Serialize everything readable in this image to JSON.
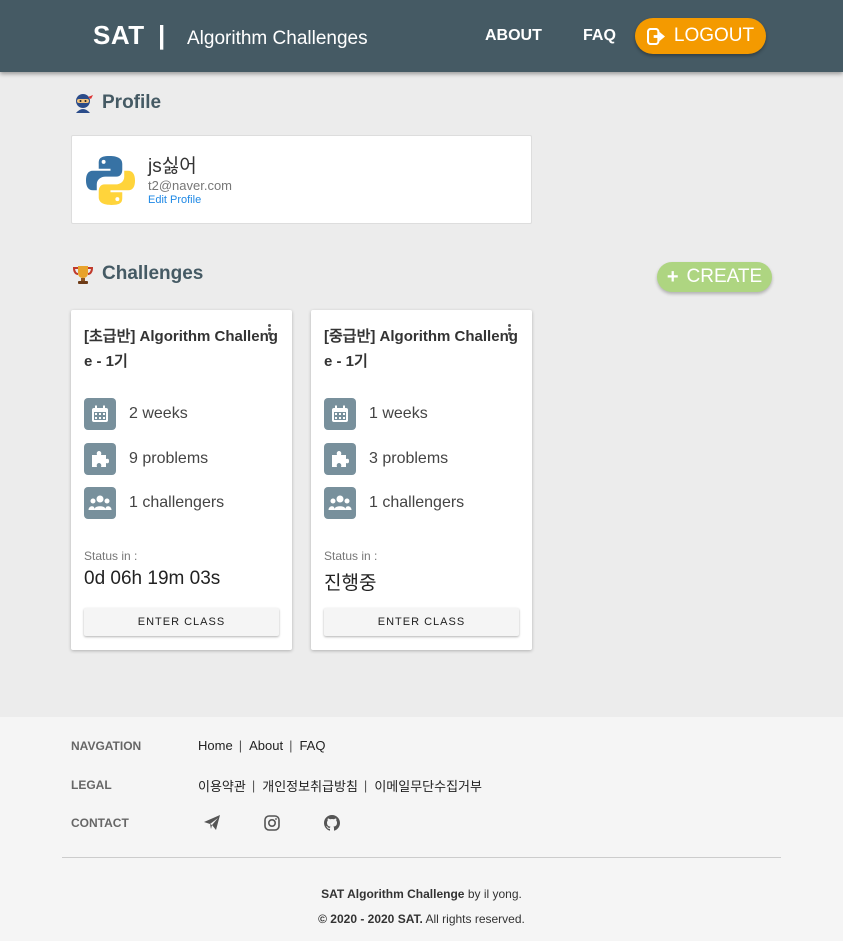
{
  "header": {
    "brand": "SAT",
    "separator": "|",
    "subtitle": "Algorithm Challenges",
    "nav": {
      "about": "ABOUT",
      "faq": "FAQ",
      "logout": "LOGOUT"
    }
  },
  "profile": {
    "heading": "Profile",
    "name": "js싫어",
    "email": "t2@naver.com",
    "edit_link": "Edit Profile"
  },
  "challenges": {
    "heading": "Challenges",
    "create_label": "CREATE",
    "create_symbol": "+",
    "cards": [
      {
        "title": "[초급반] Algorithm Challenge - 1기",
        "duration": "2 weeks",
        "problems": "9 problems",
        "challengers": "1 challengers",
        "status_label": "Status in :",
        "status_value": "0d 06h 19m 03s",
        "enter_label": "ENTER CLASS"
      },
      {
        "title": "[중급반] Algorithm Challenge - 1기",
        "duration": "1 weeks",
        "problems": "3 problems",
        "challengers": "1 challengers",
        "status_label": "Status in :",
        "status_value": "진행중",
        "enter_label": "ENTER CLASS"
      }
    ]
  },
  "footer": {
    "navigation_label": "NAVGATION",
    "navigation_links": [
      "Home",
      "About",
      "FAQ"
    ],
    "legal_label": "LEGAL",
    "legal_links": [
      "이용약관",
      "개인정보취급방침",
      "이메일무단수집거부"
    ],
    "contact_label": "CONTACT",
    "contact_icons": [
      "paper-plane-icon",
      "instagram-icon",
      "github-icon"
    ],
    "credit_strong": "SAT Algorithm Challenge",
    "credit_rest": " by il yong.",
    "copyright_strong": "© 2020 - 2020 SAT.",
    "copyright_rest": " All rights reserved.",
    "link_separator": "|"
  },
  "colors": {
    "header_bg": "#455a64",
    "logout_bg": "#f49a00",
    "create_bg": "#aed581",
    "stat_icon_bg": "#78909c",
    "link": "#1e88e5"
  }
}
